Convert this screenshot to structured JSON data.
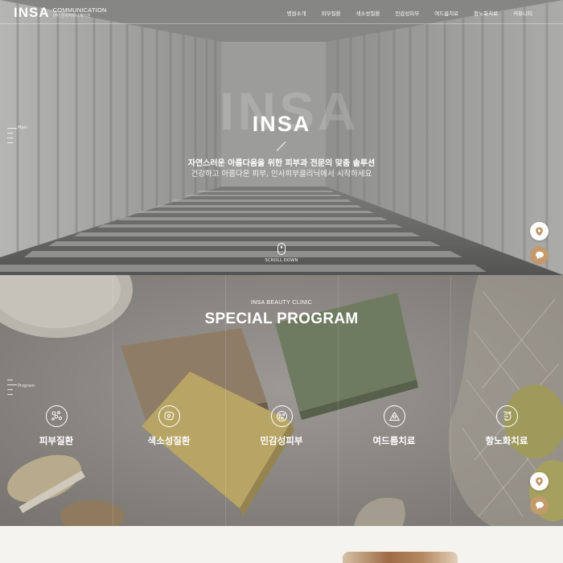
{
  "brand": {
    "logo_main": "INSA",
    "logo_sub_en": "COMMUNICATION",
    "logo_sub_ko": "(주) 인사커뮤니케이션"
  },
  "nav": {
    "items": [
      {
        "label": "병원소개"
      },
      {
        "label": "피부질환"
      },
      {
        "label": "색소성질환"
      },
      {
        "label": "민감성피부"
      },
      {
        "label": "여드름치료"
      },
      {
        "label": "항노화치료"
      },
      {
        "label": "커뮤니티"
      }
    ]
  },
  "hero": {
    "section_label": "Main",
    "ghost_text": "INSA",
    "title": "INSA",
    "subtitle_line1": "자연스러운 아름다움을 위한 피부과 전문의 맞춤 솔루션",
    "subtitle_line2": "건강하고 아름다운 피부, 인사피부클리닉에서 시작하세요",
    "scroll_label": "SCROLL DOWN"
  },
  "program": {
    "section_label": "Program",
    "kicker": "INSA BEAUTY CLINIC",
    "title": "SPECIAL PROGRAM",
    "items": [
      {
        "label": "피부질환",
        "icon": "skin-disease-icon"
      },
      {
        "label": "색소성질환",
        "icon": "pigment-icon"
      },
      {
        "label": "민감성피부",
        "icon": "sensitive-skin-icon"
      },
      {
        "label": "여드름치료",
        "icon": "acne-icon"
      },
      {
        "label": "항노화치료",
        "icon": "anti-aging-icon"
      }
    ]
  },
  "floating": {
    "location_icon": "map-pin-icon",
    "chat_icon": "chat-bubble-icon"
  },
  "colors": {
    "accent_tan": "#c39a6c",
    "text_white": "#ffffff"
  }
}
